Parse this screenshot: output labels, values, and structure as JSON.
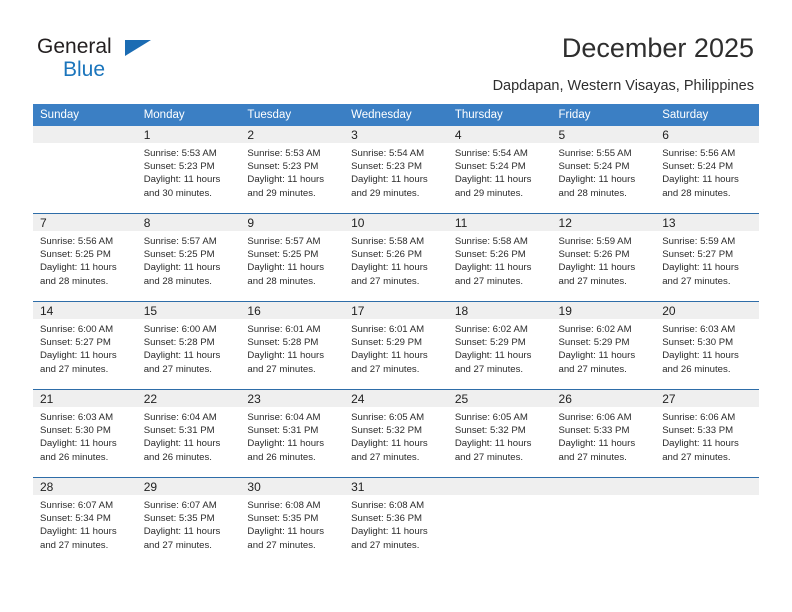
{
  "brand": {
    "name_line1": "General",
    "name_line2": "Blue",
    "accent_color": "#1b75bc",
    "triangle_color": "#1b6cb3"
  },
  "header": {
    "title": "December 2025",
    "subtitle": "Dapdapan, Western Visayas, Philippines"
  },
  "calendar": {
    "header_bg": "#3b7fc4",
    "daynum_bg": "#efefef",
    "separator_color": "#2e6da8",
    "weekday_headers": [
      "Sunday",
      "Monday",
      "Tuesday",
      "Wednesday",
      "Thursday",
      "Friday",
      "Saturday"
    ],
    "weeks": [
      [
        {
          "day": "",
          "sunrise": "",
          "sunset": "",
          "daylight_line1": "",
          "daylight_line2": ""
        },
        {
          "day": "1",
          "sunrise": "Sunrise: 5:53 AM",
          "sunset": "Sunset: 5:23 PM",
          "daylight_line1": "Daylight: 11 hours",
          "daylight_line2": "and 30 minutes."
        },
        {
          "day": "2",
          "sunrise": "Sunrise: 5:53 AM",
          "sunset": "Sunset: 5:23 PM",
          "daylight_line1": "Daylight: 11 hours",
          "daylight_line2": "and 29 minutes."
        },
        {
          "day": "3",
          "sunrise": "Sunrise: 5:54 AM",
          "sunset": "Sunset: 5:23 PM",
          "daylight_line1": "Daylight: 11 hours",
          "daylight_line2": "and 29 minutes."
        },
        {
          "day": "4",
          "sunrise": "Sunrise: 5:54 AM",
          "sunset": "Sunset: 5:24 PM",
          "daylight_line1": "Daylight: 11 hours",
          "daylight_line2": "and 29 minutes."
        },
        {
          "day": "5",
          "sunrise": "Sunrise: 5:55 AM",
          "sunset": "Sunset: 5:24 PM",
          "daylight_line1": "Daylight: 11 hours",
          "daylight_line2": "and 28 minutes."
        },
        {
          "day": "6",
          "sunrise": "Sunrise: 5:56 AM",
          "sunset": "Sunset: 5:24 PM",
          "daylight_line1": "Daylight: 11 hours",
          "daylight_line2": "and 28 minutes."
        }
      ],
      [
        {
          "day": "7",
          "sunrise": "Sunrise: 5:56 AM",
          "sunset": "Sunset: 5:25 PM",
          "daylight_line1": "Daylight: 11 hours",
          "daylight_line2": "and 28 minutes."
        },
        {
          "day": "8",
          "sunrise": "Sunrise: 5:57 AM",
          "sunset": "Sunset: 5:25 PM",
          "daylight_line1": "Daylight: 11 hours",
          "daylight_line2": "and 28 minutes."
        },
        {
          "day": "9",
          "sunrise": "Sunrise: 5:57 AM",
          "sunset": "Sunset: 5:25 PM",
          "daylight_line1": "Daylight: 11 hours",
          "daylight_line2": "and 28 minutes."
        },
        {
          "day": "10",
          "sunrise": "Sunrise: 5:58 AM",
          "sunset": "Sunset: 5:26 PM",
          "daylight_line1": "Daylight: 11 hours",
          "daylight_line2": "and 27 minutes."
        },
        {
          "day": "11",
          "sunrise": "Sunrise: 5:58 AM",
          "sunset": "Sunset: 5:26 PM",
          "daylight_line1": "Daylight: 11 hours",
          "daylight_line2": "and 27 minutes."
        },
        {
          "day": "12",
          "sunrise": "Sunrise: 5:59 AM",
          "sunset": "Sunset: 5:26 PM",
          "daylight_line1": "Daylight: 11 hours",
          "daylight_line2": "and 27 minutes."
        },
        {
          "day": "13",
          "sunrise": "Sunrise: 5:59 AM",
          "sunset": "Sunset: 5:27 PM",
          "daylight_line1": "Daylight: 11 hours",
          "daylight_line2": "and 27 minutes."
        }
      ],
      [
        {
          "day": "14",
          "sunrise": "Sunrise: 6:00 AM",
          "sunset": "Sunset: 5:27 PM",
          "daylight_line1": "Daylight: 11 hours",
          "daylight_line2": "and 27 minutes."
        },
        {
          "day": "15",
          "sunrise": "Sunrise: 6:00 AM",
          "sunset": "Sunset: 5:28 PM",
          "daylight_line1": "Daylight: 11 hours",
          "daylight_line2": "and 27 minutes."
        },
        {
          "day": "16",
          "sunrise": "Sunrise: 6:01 AM",
          "sunset": "Sunset: 5:28 PM",
          "daylight_line1": "Daylight: 11 hours",
          "daylight_line2": "and 27 minutes."
        },
        {
          "day": "17",
          "sunrise": "Sunrise: 6:01 AM",
          "sunset": "Sunset: 5:29 PM",
          "daylight_line1": "Daylight: 11 hours",
          "daylight_line2": "and 27 minutes."
        },
        {
          "day": "18",
          "sunrise": "Sunrise: 6:02 AM",
          "sunset": "Sunset: 5:29 PM",
          "daylight_line1": "Daylight: 11 hours",
          "daylight_line2": "and 27 minutes."
        },
        {
          "day": "19",
          "sunrise": "Sunrise: 6:02 AM",
          "sunset": "Sunset: 5:29 PM",
          "daylight_line1": "Daylight: 11 hours",
          "daylight_line2": "and 27 minutes."
        },
        {
          "day": "20",
          "sunrise": "Sunrise: 6:03 AM",
          "sunset": "Sunset: 5:30 PM",
          "daylight_line1": "Daylight: 11 hours",
          "daylight_line2": "and 26 minutes."
        }
      ],
      [
        {
          "day": "21",
          "sunrise": "Sunrise: 6:03 AM",
          "sunset": "Sunset: 5:30 PM",
          "daylight_line1": "Daylight: 11 hours",
          "daylight_line2": "and 26 minutes."
        },
        {
          "day": "22",
          "sunrise": "Sunrise: 6:04 AM",
          "sunset": "Sunset: 5:31 PM",
          "daylight_line1": "Daylight: 11 hours",
          "daylight_line2": "and 26 minutes."
        },
        {
          "day": "23",
          "sunrise": "Sunrise: 6:04 AM",
          "sunset": "Sunset: 5:31 PM",
          "daylight_line1": "Daylight: 11 hours",
          "daylight_line2": "and 26 minutes."
        },
        {
          "day": "24",
          "sunrise": "Sunrise: 6:05 AM",
          "sunset": "Sunset: 5:32 PM",
          "daylight_line1": "Daylight: 11 hours",
          "daylight_line2": "and 27 minutes."
        },
        {
          "day": "25",
          "sunrise": "Sunrise: 6:05 AM",
          "sunset": "Sunset: 5:32 PM",
          "daylight_line1": "Daylight: 11 hours",
          "daylight_line2": "and 27 minutes."
        },
        {
          "day": "26",
          "sunrise": "Sunrise: 6:06 AM",
          "sunset": "Sunset: 5:33 PM",
          "daylight_line1": "Daylight: 11 hours",
          "daylight_line2": "and 27 minutes."
        },
        {
          "day": "27",
          "sunrise": "Sunrise: 6:06 AM",
          "sunset": "Sunset: 5:33 PM",
          "daylight_line1": "Daylight: 11 hours",
          "daylight_line2": "and 27 minutes."
        }
      ],
      [
        {
          "day": "28",
          "sunrise": "Sunrise: 6:07 AM",
          "sunset": "Sunset: 5:34 PM",
          "daylight_line1": "Daylight: 11 hours",
          "daylight_line2": "and 27 minutes."
        },
        {
          "day": "29",
          "sunrise": "Sunrise: 6:07 AM",
          "sunset": "Sunset: 5:35 PM",
          "daylight_line1": "Daylight: 11 hours",
          "daylight_line2": "and 27 minutes."
        },
        {
          "day": "30",
          "sunrise": "Sunrise: 6:08 AM",
          "sunset": "Sunset: 5:35 PM",
          "daylight_line1": "Daylight: 11 hours",
          "daylight_line2": "and 27 minutes."
        },
        {
          "day": "31",
          "sunrise": "Sunrise: 6:08 AM",
          "sunset": "Sunset: 5:36 PM",
          "daylight_line1": "Daylight: 11 hours",
          "daylight_line2": "and 27 minutes."
        },
        {
          "day": "",
          "sunrise": "",
          "sunset": "",
          "daylight_line1": "",
          "daylight_line2": ""
        },
        {
          "day": "",
          "sunrise": "",
          "sunset": "",
          "daylight_line1": "",
          "daylight_line2": ""
        },
        {
          "day": "",
          "sunrise": "",
          "sunset": "",
          "daylight_line1": "",
          "daylight_line2": ""
        }
      ]
    ]
  }
}
